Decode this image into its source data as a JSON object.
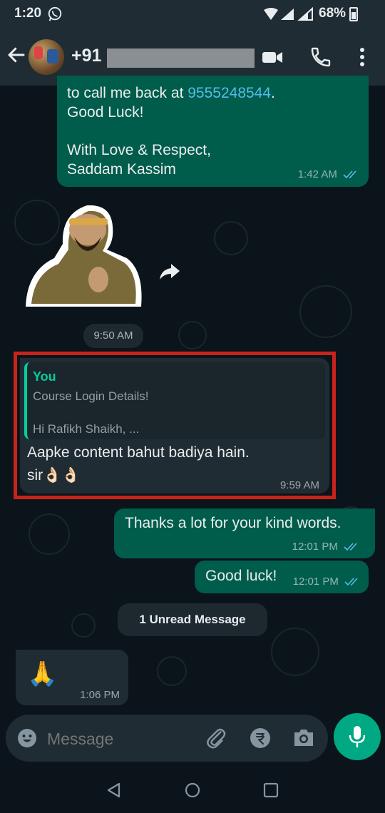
{
  "status_bar": {
    "time": "1:20",
    "battery": "68%",
    "battery_level": 0.68
  },
  "header": {
    "contact_prefix": "+91"
  },
  "messages": {
    "msg1": {
      "line1_prefix": "to call me back at ",
      "phone": "9555248544",
      "line1_suffix": ".",
      "line2": "Good Luck!",
      "line4": "With Love & Respect,",
      "line5": "Saddam Kassim",
      "time": "1:42 AM"
    },
    "sticker": {
      "time": "9:50 AM"
    },
    "reply": {
      "quoted_author": "You",
      "quoted_line1": "Course Login Details!",
      "quoted_line2": "Hi Rafikh Shaikh, ...",
      "text_line1": "Aapke content bahut badiya hain.",
      "text_line2": "sir👌🏻👌🏻",
      "time": "9:59 AM"
    },
    "thanks": {
      "text": "Thanks a lot for your kind words.",
      "time": "12:01 PM"
    },
    "goodluck": {
      "text": "Good luck!",
      "time": "12:01 PM"
    },
    "unread": "1 Unread Message",
    "pray": {
      "emoji": "🙏",
      "time": "1:06 PM"
    }
  },
  "input": {
    "placeholder": "Message"
  },
  "colors": {
    "outgoing": "#005c4b",
    "incoming": "#202c33",
    "accent": "#00a884",
    "link": "#53bdeb",
    "highlight_box": "#c8231b"
  },
  "icons": [
    "back-arrow-icon",
    "video-call-icon",
    "phone-icon",
    "more-icon",
    "forward-icon",
    "double-check-icon",
    "emoji-icon",
    "attach-icon",
    "rupee-icon",
    "camera-icon",
    "mic-icon",
    "nav-back-icon",
    "nav-home-icon",
    "nav-recents-icon"
  ]
}
